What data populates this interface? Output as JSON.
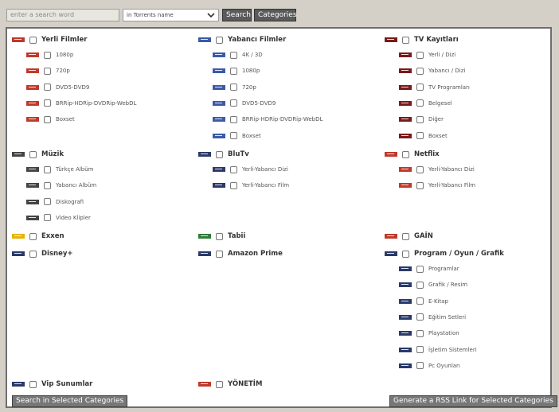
{
  "search": {
    "placeholder": "enter a search word",
    "mode": "in Torrents name",
    "search_button": "Search",
    "categories_button": "Categories"
  },
  "colors": {
    "red": "#c0392b",
    "blue": "#3c5aa8",
    "navy": "#2a3a6a",
    "maroon": "#7a1a1a",
    "yellow": "#e7b300",
    "green": "#2e7d3a",
    "dark": "#444444"
  },
  "categories": [
    {
      "id": "yerli-filmler",
      "label": "Yerli Filmler",
      "icon": "red",
      "items": [
        {
          "label": "1080p",
          "icon": "red"
        },
        {
          "label": "720p",
          "icon": "red"
        },
        {
          "label": "DVD5-DVD9",
          "icon": "red"
        },
        {
          "label": "BRRip-HDRip-DVDRip-WebDL",
          "icon": "red"
        },
        {
          "label": "Boxset",
          "icon": "red"
        }
      ]
    },
    {
      "id": "yabanci-filmler",
      "label": "Yabancı Filmler",
      "icon": "blue",
      "items": [
        {
          "label": "4K / 3D",
          "icon": "blue"
        },
        {
          "label": "1080p",
          "icon": "blue"
        },
        {
          "label": "720p",
          "icon": "blue"
        },
        {
          "label": "DVD5-DVD9",
          "icon": "blue"
        },
        {
          "label": "BRRip-HDRip-DVDRip-WebDL",
          "icon": "blue"
        },
        {
          "label": "Boxset",
          "icon": "blue"
        }
      ]
    },
    {
      "id": "tv-kayitlari",
      "label": "TV Kayıtları",
      "icon": "maroon",
      "items": [
        {
          "label": "Yerli / Dizi",
          "icon": "maroon"
        },
        {
          "label": "Yabancı / Dizi",
          "icon": "maroon"
        },
        {
          "label": "TV Programları",
          "icon": "maroon"
        },
        {
          "label": "Belgesel",
          "icon": "maroon"
        },
        {
          "label": "Diğer",
          "icon": "maroon"
        },
        {
          "label": "Boxset",
          "icon": "maroon"
        }
      ]
    },
    {
      "id": "muzik",
      "label": "Müzik",
      "icon": "dark",
      "items": [
        {
          "label": "Türkçe Albüm",
          "icon": "dark"
        },
        {
          "label": "Yabancı Albüm",
          "icon": "dark"
        },
        {
          "label": "Diskografi",
          "icon": "dark"
        },
        {
          "label": "Video Klipler",
          "icon": "dark"
        }
      ]
    },
    {
      "id": "blutv",
      "label": "BluTv",
      "icon": "navy",
      "items": [
        {
          "label": "Yerli-Yabancı Dizi",
          "icon": "navy"
        },
        {
          "label": "Yerli-Yabancı Film",
          "icon": "navy"
        }
      ]
    },
    {
      "id": "netflix",
      "label": "Netflix",
      "icon": "red",
      "items": [
        {
          "label": "Yerli-Yabancı Dizi",
          "icon": "red"
        },
        {
          "label": "Yerli-Yabancı Film",
          "icon": "red"
        }
      ]
    },
    {
      "id": "exxen",
      "label": "Exxen",
      "icon": "yellow",
      "items": []
    },
    {
      "id": "tabii",
      "label": "Tabii",
      "icon": "green",
      "items": []
    },
    {
      "id": "gain",
      "label": "GAİN",
      "icon": "red",
      "items": []
    },
    {
      "id": "disney",
      "label": "Disney+",
      "icon": "navy",
      "items": []
    },
    {
      "id": "amazon",
      "label": "Amazon Prime",
      "icon": "navy",
      "items": []
    },
    {
      "id": "program",
      "label": "Program / Oyun / Grafik",
      "icon": "navy",
      "items": [
        {
          "label": "Programlar",
          "icon": "navy"
        },
        {
          "label": "Grafik / Resim",
          "icon": "navy"
        },
        {
          "label": "E-Kitap",
          "icon": "navy"
        },
        {
          "label": "Eğitim Setleri",
          "icon": "navy"
        },
        {
          "label": "Playstation",
          "icon": "navy"
        },
        {
          "label": "İşletim Sistemleri",
          "icon": "navy"
        },
        {
          "label": "Pc Oyunları",
          "icon": "navy"
        }
      ]
    },
    {
      "id": "vip",
      "label": "Vip Sunumlar",
      "icon": "navy",
      "items": []
    },
    {
      "id": "yonetim",
      "label": "YÖNETİM",
      "icon": "red",
      "items": []
    }
  ],
  "actions": {
    "search_selected": "Search in Selected Categories",
    "rss": "Generate a RSS Link for Selected Categories"
  }
}
